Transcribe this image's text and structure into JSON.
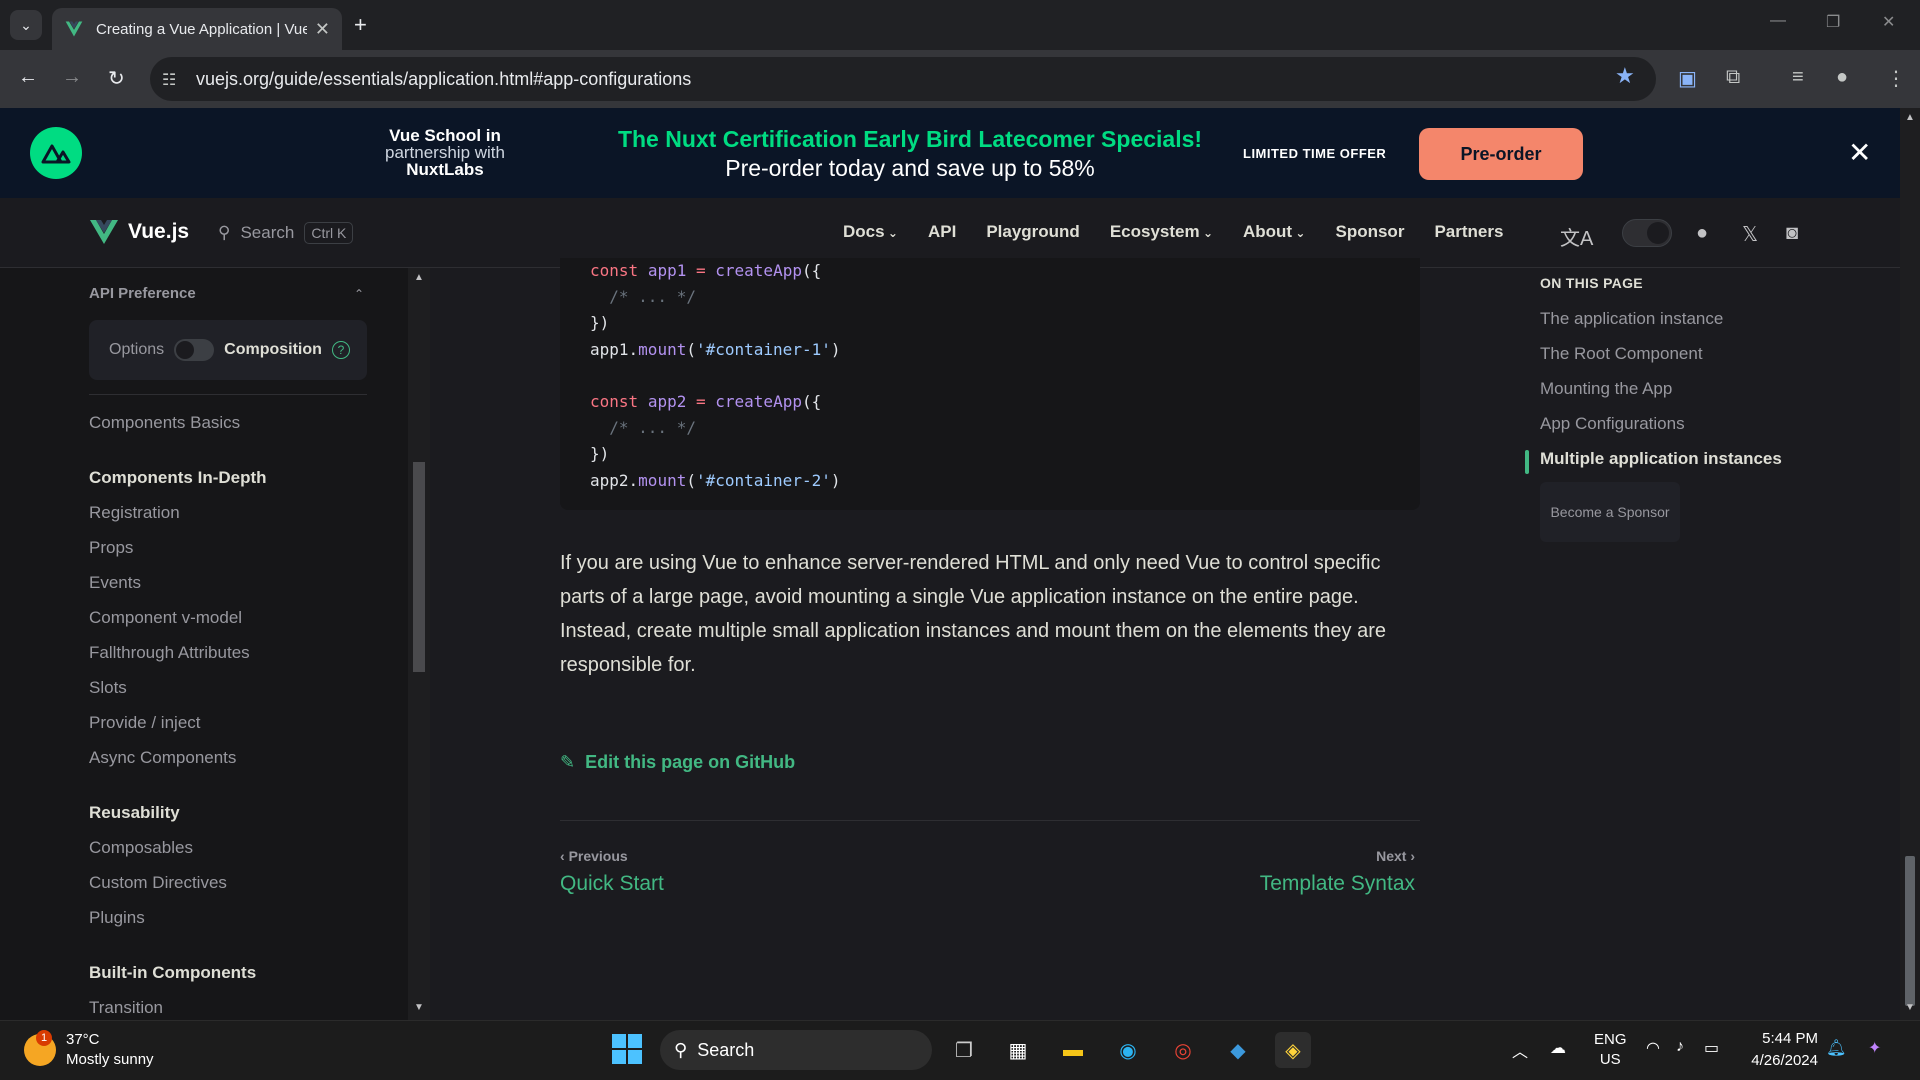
{
  "browser": {
    "tab_title": "Creating a Vue Application | Vue.js",
    "url": "vuejs.org/guide/essentials/application.html#app-configurations"
  },
  "banner": {
    "vs_line1": "Vue School in",
    "vs_line2": "partnership with",
    "vs_line3": "NuxtLabs",
    "headline": "The Nuxt Certification Early Bird Latecomer Specials!",
    "subline": "Pre-order today and save up to 58%",
    "limited": "LIMITED TIME OFFER",
    "cta": "Pre-order"
  },
  "nav": {
    "logo": "Vue.js",
    "search": "Search",
    "search_kbd": "Ctrl K",
    "links": [
      "Docs",
      "API",
      "Playground",
      "Ecosystem",
      "About",
      "Sponsor",
      "Partners"
    ]
  },
  "sidebar": {
    "api_pref": "API Preference",
    "opt_options": "Options",
    "opt_composition": "Composition",
    "items": {
      "components_basics": "Components Basics",
      "head_indepth": "Components In-Depth",
      "registration": "Registration",
      "props": "Props",
      "events": "Events",
      "vmodel": "Component v-model",
      "fallthrough": "Fallthrough Attributes",
      "slots": "Slots",
      "provide": "Provide / inject",
      "async": "Async Components",
      "head_reuse": "Reusability",
      "composables": "Composables",
      "directives": "Custom Directives",
      "plugins": "Plugins",
      "head_builtin": "Built-in Components",
      "transition": "Transition"
    }
  },
  "content": {
    "code_lines": [
      "const app1 = createApp({",
      "  /* ... */",
      "})",
      "app1.mount('#container-1')",
      "",
      "const app2 = createApp({",
      "  /* ... */",
      "})",
      "app2.mount('#container-2')"
    ],
    "paragraph": "If you are using Vue to enhance server-rendered HTML and only need Vue to control specific parts of a large page, avoid mounting a single Vue application instance on the entire page. Instead, create multiple small application instances and mount them on the elements they are responsible for.",
    "edit_link": "Edit this page on GitHub",
    "prev_label": "Previous",
    "prev_title": "Quick Start",
    "next_label": "Next",
    "next_title": "Template Syntax"
  },
  "toc": {
    "heading": "ON THIS PAGE",
    "items": [
      "The application instance",
      "The Root Component",
      "Mounting the App",
      "App Configurations",
      "Multiple application instances"
    ],
    "sponsor": "Become a Sponsor"
  },
  "taskbar": {
    "temp": "37°C",
    "weather": "Mostly sunny",
    "search": "Search",
    "lang1": "ENG",
    "lang2": "US",
    "time": "5:44 PM",
    "date": "4/26/2024",
    "badge": "1"
  },
  "colors": {
    "accent": "#42b883",
    "banner_bg": "#0b1526",
    "nuxt_green": "#00dc82",
    "cta": "#f4866b"
  }
}
